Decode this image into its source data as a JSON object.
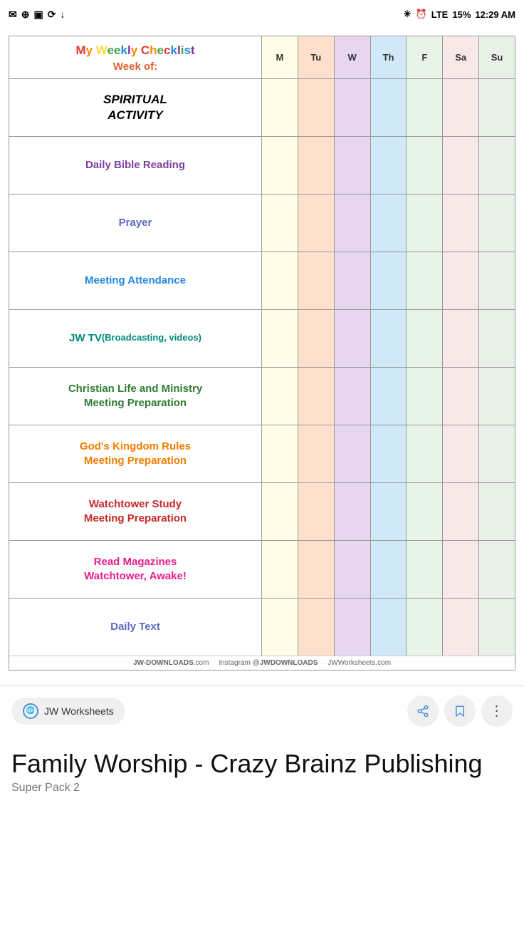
{
  "statusBar": {
    "time": "12:29 AM",
    "battery": "15%",
    "signal": "LTE"
  },
  "header": {
    "weeklyChecklist": "My Weekly Checklist",
    "weekOf": "Week of:"
  },
  "spiritualActivityLabel": "SPIRITUAL\nACTIVITY",
  "days": [
    "M",
    "Tu",
    "W",
    "Th",
    "F",
    "Sa",
    "Su"
  ],
  "activities": [
    {
      "label": "Daily Bible Reading",
      "colorClass": "color-purple"
    },
    {
      "label": "Prayer",
      "colorClass": "color-indigo"
    },
    {
      "label": "Meeting Attendance",
      "colorClass": "color-blue"
    },
    {
      "label": "JW TV\n(Broadcasting, videos)",
      "colorClass": "color-teal"
    },
    {
      "label": "Christian Life and Ministry Meeting Preparation",
      "colorClass": "color-green-dark"
    },
    {
      "label": "God's Kingdom Rules Meeting Preparation",
      "colorClass": "color-orange"
    },
    {
      "label": "Watchtower Study Meeting Preparation",
      "colorClass": "color-red"
    },
    {
      "label": "Read Magazines Watchtower, Awake!",
      "colorClass": "color-pink"
    },
    {
      "label": "Daily Text",
      "colorClass": "color-medium-blue"
    }
  ],
  "footer": "JW-DOWNLOADS.com    Instagram @JWDOWNLOADS    JWWorksheets.com",
  "siteLabel": "JW Worksheets",
  "pageTitle": "Family Worship - Crazy Brainz Publishing",
  "pageSubtitle": "Super Pack 2"
}
